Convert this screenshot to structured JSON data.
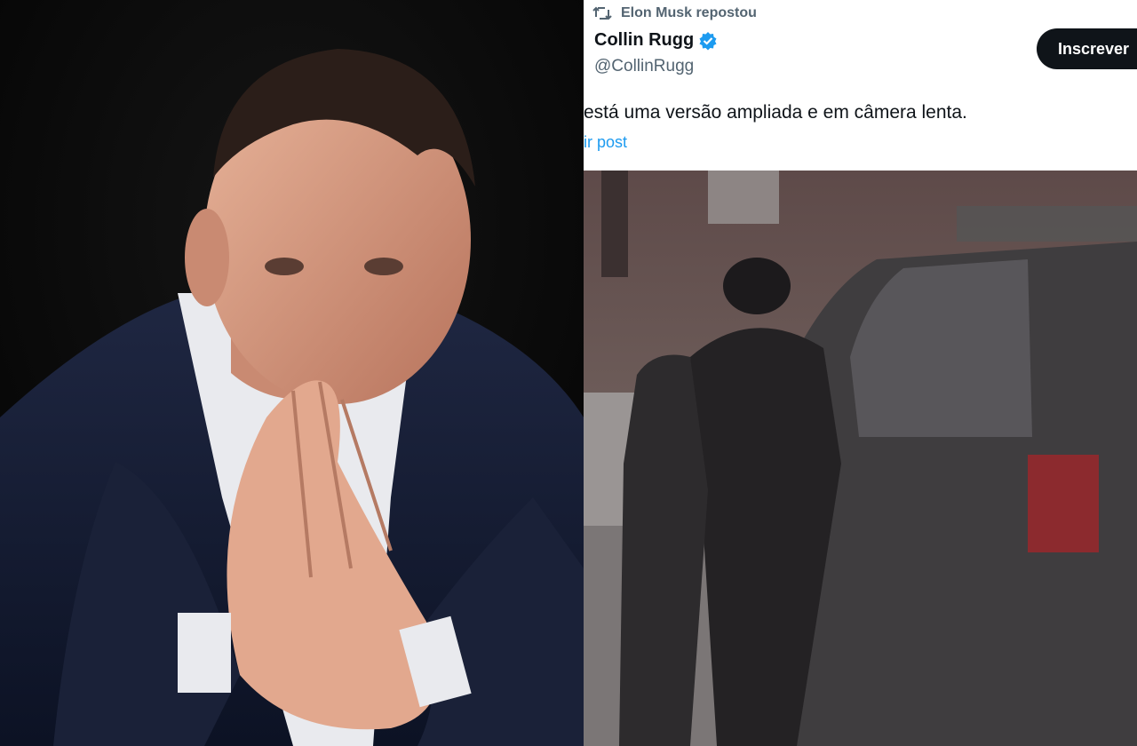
{
  "photo": {
    "subject_description": "photo-of-man-in-suit-with-fingertips-pressed-together"
  },
  "tweet": {
    "repost_text": "Elon Musk repostou",
    "author_name": "Collin Rugg",
    "author_handle": "@CollinRugg",
    "subscribe_label": "Inscrever",
    "text": "está uma versão ampliada e em câmera lenta.",
    "translate_link": "ir post",
    "icons": {
      "repost": "repost-icon",
      "verified": "verified-badge-icon"
    }
  },
  "colors": {
    "text_primary": "#0f1419",
    "text_secondary": "#536471",
    "link": "#1d9bf0",
    "verified": "#1d9bf0",
    "button_bg": "#0f1419"
  }
}
